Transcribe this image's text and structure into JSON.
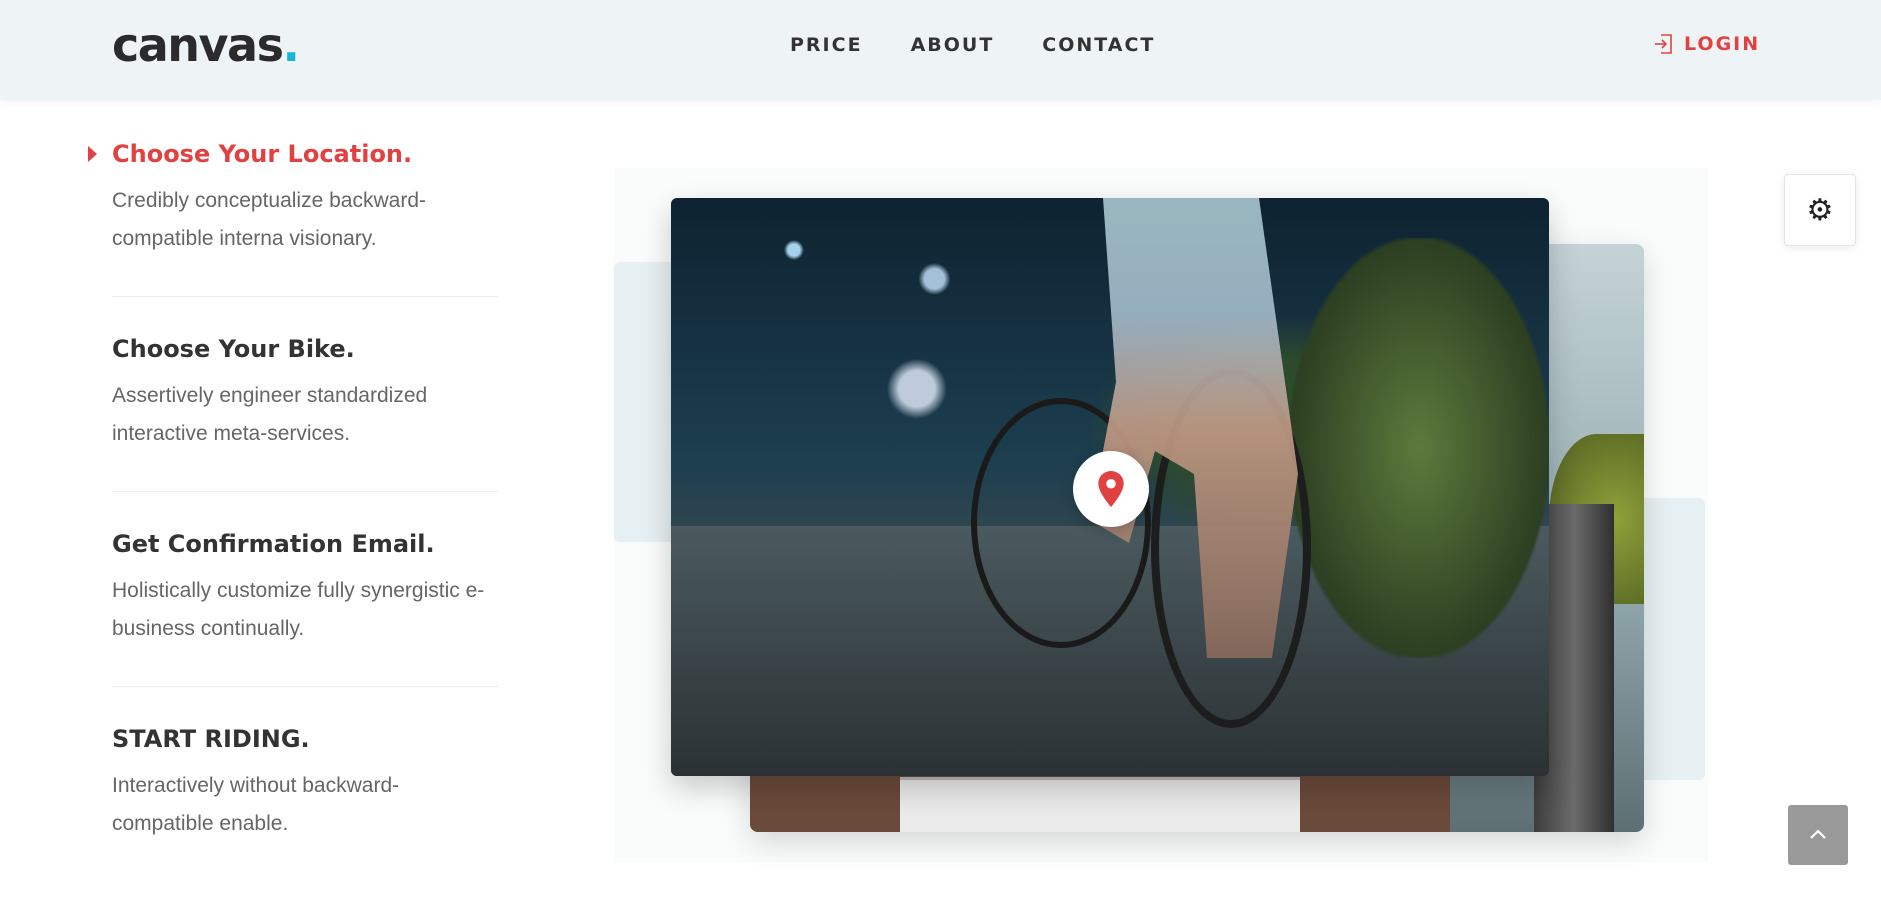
{
  "header": {
    "logo_text": "canvas",
    "logo_dot": ".",
    "nav": [
      "PRICE",
      "ABOUT",
      "CONTACT"
    ],
    "login_label": "LOGIN"
  },
  "steps": [
    {
      "title": "Choose Your Location.",
      "text": "Credibly conceptualize backward-compatible interna visionary.",
      "active": true
    },
    {
      "title": "Choose Your Bike.",
      "text": "Assertively engineer standardized interactive meta-services.",
      "active": false
    },
    {
      "title": "Get Confirmation Email.",
      "text": "Holistically customize fully synergistic e-business continually.",
      "active": false
    },
    {
      "title": "START RIDING.",
      "text": "Interactively without backward-compatible enable.",
      "active": false
    }
  ],
  "icons": {
    "login": "login-icon",
    "pin": "map-pin-icon",
    "settings": "gears-icon",
    "back_to_top": "chevron-up-icon"
  },
  "colors": {
    "accent": "#e24141",
    "logo_dot": "#17b5d6",
    "header_bg": "#eef4f5"
  }
}
